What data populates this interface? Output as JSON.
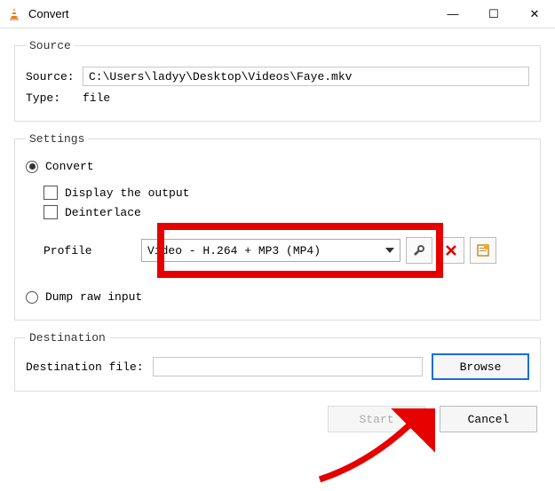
{
  "window": {
    "title": "Convert",
    "minimize": "—",
    "maximize": "☐",
    "close": "✕"
  },
  "source": {
    "legend": "Source",
    "label": "Source:",
    "value": "C:\\Users\\ladyy\\Desktop\\Videos\\Faye.mkv",
    "type_label": "Type:",
    "type_value": "file"
  },
  "settings": {
    "legend": "Settings",
    "convert": "Convert",
    "display_output": "Display the output",
    "deinterlace": "Deinterlace",
    "profile_label": "Profile",
    "profile_value": "Video - H.264 + MP3 (MP4)",
    "dump": "Dump raw input"
  },
  "destination": {
    "legend": "Destination",
    "label": "Destination file:",
    "browse": "Browse"
  },
  "buttons": {
    "start": "Start",
    "cancel": "Cancel"
  },
  "icons": {
    "wrench": "wrench-icon",
    "delete": "delete-icon",
    "new_profile": "new-profile-icon"
  }
}
